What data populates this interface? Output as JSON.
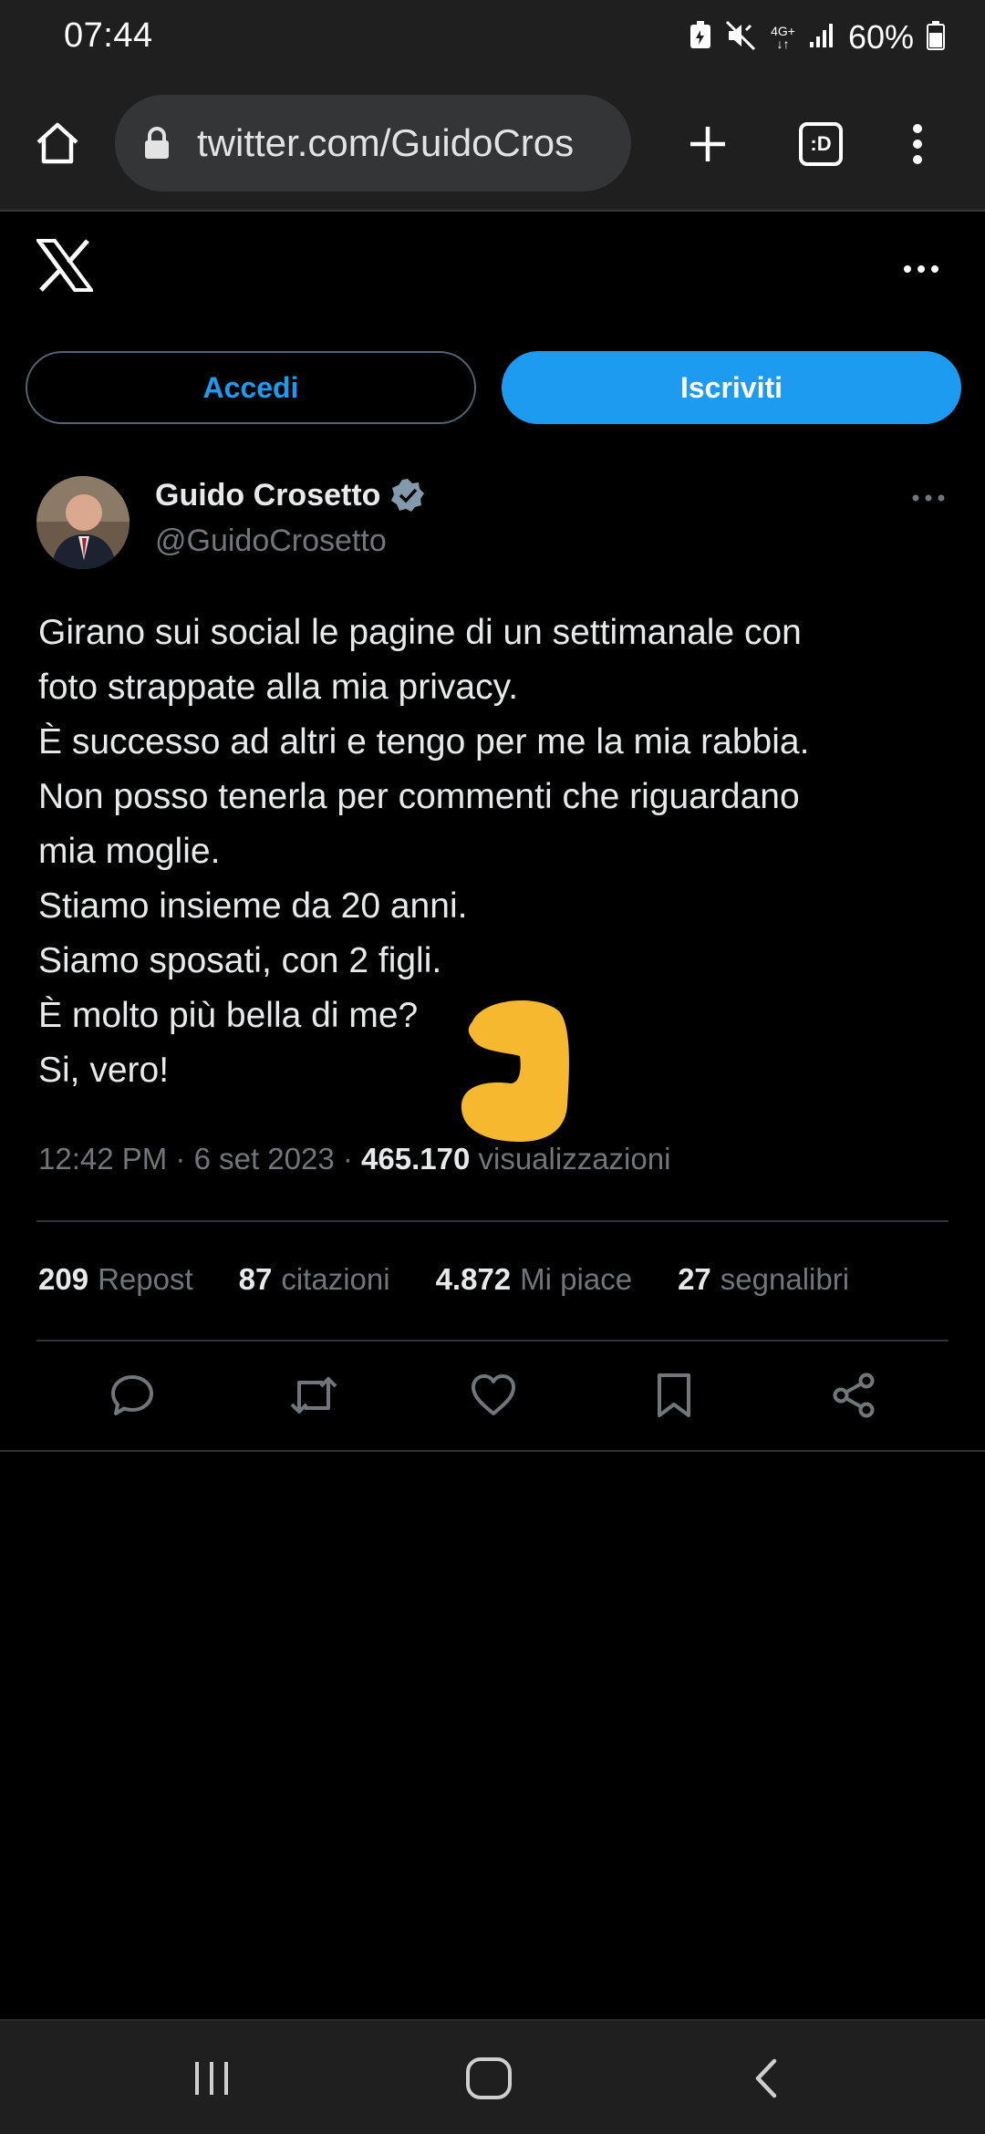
{
  "status_bar": {
    "time": "07:44",
    "network": "4G+",
    "battery_percent": "60%",
    "icons": [
      "battery-saver-icon",
      "mute-icon",
      "network-4g-icon",
      "signal-icon",
      "battery-icon"
    ]
  },
  "browser": {
    "url": "twitter.com/GuidoCros",
    "tab_indicator": ":D",
    "icons": [
      "home-icon",
      "lock-icon",
      "plus-icon",
      "tabs-icon",
      "kebab-menu-icon"
    ]
  },
  "header": {
    "logo": "x-logo",
    "more_icon": "more-horizontal-icon"
  },
  "auth": {
    "login_label": "Accedi",
    "signup_label": "Iscriviti"
  },
  "tweet": {
    "author_name": "Guido Crosetto",
    "author_handle": "@GuidoCrosetto",
    "verified": true,
    "lines": [
      "Girano sui social le pagine di un settimanale con",
      "foto strappate alla mia privacy.",
      "È successo ad altri e tengo per me la mia rabbia.",
      "Non posso tenerla per commenti che riguardano",
      "mia moglie.",
      "Stiamo insieme da 20 anni.",
      "Siamo sposati, con 2 figli.",
      "È molto più bella di me?",
      "Si, vero!"
    ],
    "time": "12:42 PM",
    "date": "6 set 2023",
    "views_count": "465.170",
    "views_label": "visualizzazioni",
    "stats": [
      {
        "count": "209",
        "label": "Repost"
      },
      {
        "count": "87",
        "label": "citazioni"
      },
      {
        "count": "4.872",
        "label": "Mi piace"
      },
      {
        "count": "27",
        "label": "segnalibri"
      }
    ],
    "actions": [
      "reply-icon",
      "repost-icon",
      "like-icon",
      "bookmark-icon",
      "share-icon"
    ]
  },
  "colors": {
    "accent": "#1d9bf0",
    "background": "#000000",
    "muted_text": "#71767b",
    "scribble": "#f5b82e"
  }
}
